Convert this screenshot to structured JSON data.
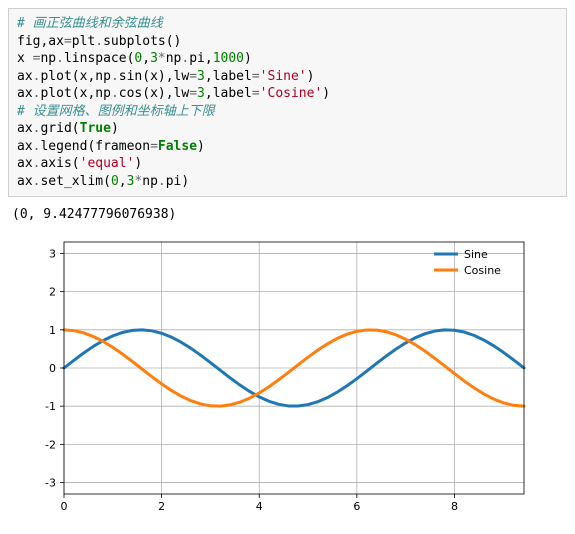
{
  "code": {
    "l1": "# 画正弦曲线和余弦曲线",
    "l2a": "fig,ax",
    "l2b": "=",
    "l2c": "plt",
    "l2d": ".",
    "l2e": "subplots()",
    "l3a": "x ",
    "l3b": "=",
    "l3c": "np",
    "l3d": ".",
    "l3e": "linspace(",
    "l3n1": "0",
    "l3f": ",",
    "l3n2": "3",
    "l3g": "*",
    "l3h": "np",
    "l3i": ".",
    "l3j": "pi,",
    "l3n3": "1000",
    "l3k": ")",
    "l4a": "ax",
    "l4b": ".",
    "l4c": "plot(x,np",
    "l4d": ".",
    "l4e": "sin(x),lw",
    "l4f": "=",
    "l4n1": "3",
    "l4g": ",label",
    "l4h": "=",
    "l4s": "'Sine'",
    "l4i": ")",
    "l5a": "ax",
    "l5b": ".",
    "l5c": "plot(x,np",
    "l5d": ".",
    "l5e": "cos(x),lw",
    "l5f": "=",
    "l5n1": "3",
    "l5g": ",label",
    "l5h": "=",
    "l5s": "'Cosine'",
    "l5i": ")",
    "l6": "# 设置网格、图例和坐标轴上下限",
    "l7a": "ax",
    "l7b": ".",
    "l7c": "grid(",
    "l7d": "True",
    "l7e": ")",
    "l8a": "ax",
    "l8b": ".",
    "l8c": "legend(frameon",
    "l8d": "=",
    "l8e": "False",
    "l8f": ")",
    "l9a": "ax",
    "l9b": ".",
    "l9c": "axis(",
    "l9s": "'equal'",
    "l9d": ")",
    "l10a": "ax",
    "l10b": ".",
    "l10c": "set_xlim(",
    "l10n1": "0",
    "l10d": ",",
    "l10n2": "3",
    "l10e": "*",
    "l10f": "np",
    "l10g": ".",
    "l10h": "pi)"
  },
  "output_text": "(0, 9.42477796076938)",
  "chart_data": {
    "type": "line",
    "title": "",
    "xlabel": "",
    "ylabel": "",
    "xlim": [
      0,
      9.42477796076938
    ],
    "ylim": [
      -3.3,
      3.3
    ],
    "xticks": [
      0,
      2,
      4,
      6,
      8
    ],
    "yticks": [
      -3,
      -2,
      -1,
      0,
      1,
      2,
      3
    ],
    "grid": true,
    "legend": {
      "position": "upper-right",
      "frameon": false,
      "items": [
        "Sine",
        "Cosine"
      ]
    },
    "series": [
      {
        "name": "Sine",
        "color": "#1f77b4",
        "lw": 3,
        "x": [
          0,
          0.2,
          0.4,
          0.6,
          0.8,
          1,
          1.2,
          1.4,
          1.6,
          1.8,
          2,
          2.2,
          2.4,
          2.6,
          2.8,
          3,
          3.2,
          3.4,
          3.6,
          3.8,
          4,
          4.2,
          4.4,
          4.6,
          4.8,
          5,
          5.2,
          5.4,
          5.6,
          5.8,
          6,
          6.2,
          6.4,
          6.6,
          6.8,
          7,
          7.2,
          7.4,
          7.6,
          7.8,
          8,
          8.2,
          8.4,
          8.6,
          8.8,
          9,
          9.2,
          9.4248
        ],
        "y": [
          0,
          0.1987,
          0.3894,
          0.5646,
          0.7174,
          0.8415,
          0.932,
          0.9854,
          0.9996,
          0.9738,
          0.9093,
          0.8085,
          0.6755,
          0.5155,
          0.335,
          0.1411,
          -0.0584,
          -0.2555,
          -0.4425,
          -0.6119,
          -0.7568,
          -0.8716,
          -0.9516,
          -0.9937,
          -0.9962,
          -0.9589,
          -0.8835,
          -0.7728,
          -0.6313,
          -0.4646,
          -0.2794,
          -0.0831,
          0.1165,
          0.3115,
          0.4941,
          0.657,
          0.7937,
          0.8987,
          0.9679,
          0.9985,
          0.9894,
          0.9407,
          0.8546,
          0.7344,
          0.5849,
          0.4121,
          0.2229,
          0
        ]
      },
      {
        "name": "Cosine",
        "color": "#ff7f0e",
        "lw": 3,
        "x": [
          0,
          0.2,
          0.4,
          0.6,
          0.8,
          1,
          1.2,
          1.4,
          1.6,
          1.8,
          2,
          2.2,
          2.4,
          2.6,
          2.8,
          3,
          3.2,
          3.4,
          3.6,
          3.8,
          4,
          4.2,
          4.4,
          4.6,
          4.8,
          5,
          5.2,
          5.4,
          5.6,
          5.8,
          6,
          6.2,
          6.4,
          6.6,
          6.8,
          7,
          7.2,
          7.4,
          7.6,
          7.8,
          8,
          8.2,
          8.4,
          8.6,
          8.8,
          9,
          9.2,
          9.4248
        ],
        "y": [
          1,
          0.9801,
          0.9211,
          0.8253,
          0.6967,
          0.5403,
          0.3624,
          0.17,
          -0.0292,
          -0.2272,
          -0.4161,
          -0.5885,
          -0.7374,
          -0.8569,
          -0.9422,
          -0.99,
          -0.9983,
          -0.9668,
          -0.8968,
          -0.791,
          -0.6536,
          -0.4903,
          -0.3073,
          -0.1122,
          0.0875,
          0.2837,
          0.4685,
          0.6347,
          0.7756,
          0.8855,
          0.9602,
          0.9965,
          0.9932,
          0.9502,
          0.8694,
          0.7539,
          0.6084,
          0.4385,
          0.2513,
          0.054,
          -0.1455,
          -0.3392,
          -0.5193,
          -0.6787,
          -0.8111,
          -0.9111,
          -0.9748,
          -1
        ]
      }
    ]
  }
}
